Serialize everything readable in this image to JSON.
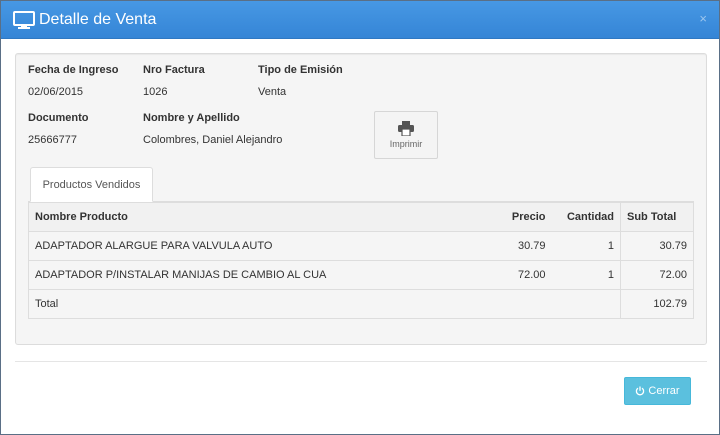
{
  "modal": {
    "title": "Detalle de Venta",
    "close_glyph": "×",
    "title_icon": "desktop-icon",
    "header_color": "#3c8dde"
  },
  "invoice": {
    "fecha_label": "Fecha de Ingreso",
    "fecha_value": "02/06/2015",
    "factura_label": "Nro Factura",
    "factura_value": "1026",
    "tipo_label": "Tipo de Emisión",
    "tipo_value": "Venta",
    "documento_label": "Documento",
    "documento_value": "25666777",
    "nombre_label": "Nombre y Apellido",
    "nombre_value": "Colombres, Daniel Alejandro"
  },
  "print": {
    "label": "Imprimir",
    "icon": "printer-icon"
  },
  "tabs": [
    {
      "label": "Productos Vendidos"
    }
  ],
  "table": {
    "headers": [
      "Nombre Producto",
      "Precio",
      "Cantidad",
      "Sub Total"
    ],
    "rows": [
      {
        "producto": "ADAPTADOR ALARGUE PARA VALVULA AUTO",
        "precio": "30.79",
        "cantidad": "1",
        "subtotal": "30.79"
      },
      {
        "producto": "ADAPTADOR P/INSTALAR MANIJAS DE CAMBIO AL CUA",
        "precio": "72.00",
        "cantidad": "1",
        "subtotal": "72.00"
      }
    ],
    "total_label": "Total",
    "total_value": "102.79"
  },
  "footer": {
    "close_label": "Cerrar",
    "close_icon": "power-icon",
    "button_color": "#5bc0de"
  }
}
